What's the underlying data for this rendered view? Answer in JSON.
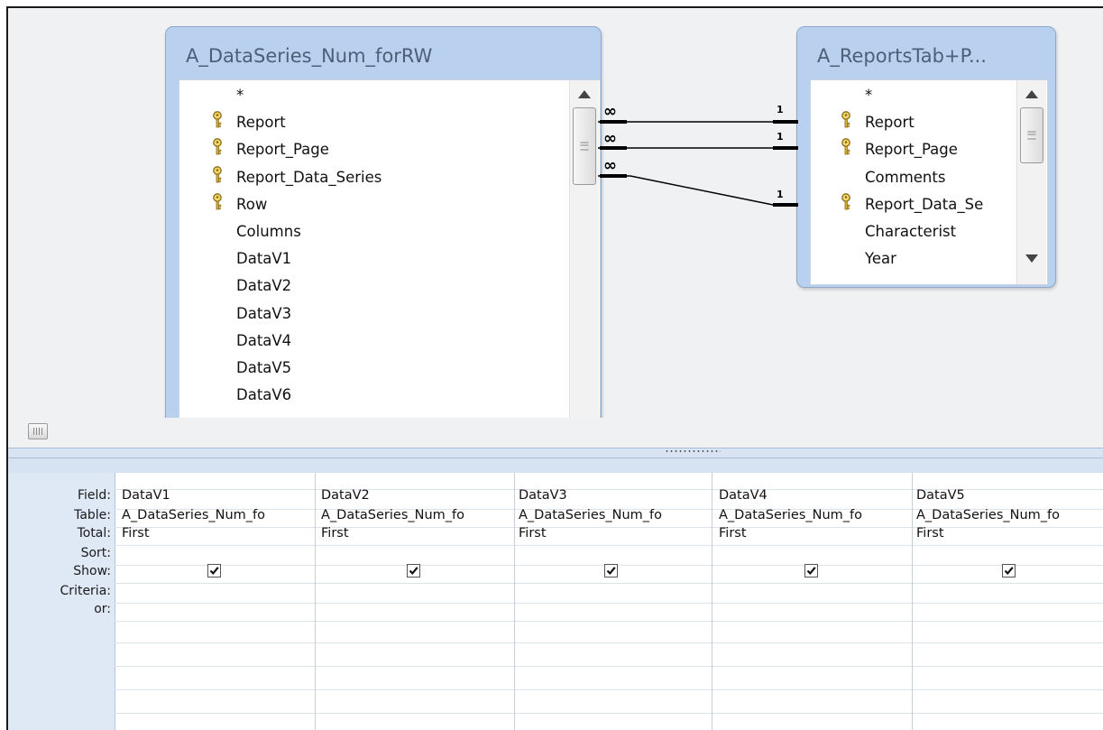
{
  "left_table": {
    "title": "A_DataSeries_Num_forRW",
    "fields": [
      {
        "name": "*",
        "key": false
      },
      {
        "name": "Report",
        "key": true
      },
      {
        "name": "Report_Page",
        "key": true
      },
      {
        "name": "Report_Data_Series",
        "key": true
      },
      {
        "name": "Row",
        "key": true
      },
      {
        "name": "Columns",
        "key": false
      },
      {
        "name": "DataV1",
        "key": false
      },
      {
        "name": "DataV2",
        "key": false
      },
      {
        "name": "DataV3",
        "key": false
      },
      {
        "name": "DataV4",
        "key": false
      },
      {
        "name": "DataV5",
        "key": false
      },
      {
        "name": "DataV6",
        "key": false
      }
    ]
  },
  "right_table": {
    "title": "A_ReportsTab+P...",
    "fields": [
      {
        "name": "*",
        "key": false
      },
      {
        "name": "Report",
        "key": true
      },
      {
        "name": "Report_Page",
        "key": true
      },
      {
        "name": "Comments",
        "key": false
      },
      {
        "name": "Report_Data_Se",
        "key": true
      },
      {
        "name": "Characterist",
        "key": false
      },
      {
        "name": "Year",
        "key": false
      }
    ]
  },
  "relationships": {
    "many_symbol": "∞",
    "one_symbol": "1"
  },
  "grid": {
    "row_labels": [
      "Field:",
      "Table:",
      "Total:",
      "Sort:",
      "Show:",
      "Criteria:",
      "or:"
    ],
    "columns": [
      {
        "field": "DataV1",
        "table": "A_DataSeries_Num_fo",
        "total": "First",
        "sort": "",
        "show": true
      },
      {
        "field": "DataV2",
        "table": "A_DataSeries_Num_fo",
        "total": "First",
        "sort": "",
        "show": true
      },
      {
        "field": "DataV3",
        "table": "A_DataSeries_Num_fo",
        "total": "First",
        "sort": "",
        "show": true
      },
      {
        "field": "DataV4",
        "table": "A_DataSeries_Num_fo",
        "total": "First",
        "sort": "",
        "show": true
      },
      {
        "field": "DataV5",
        "table": "A_DataSeries_Num_fo",
        "total": "First",
        "sort": "",
        "show": true
      }
    ]
  },
  "colors": {
    "table_frame": "#b9d1ee",
    "grid_header": "#dfe8f5",
    "relationship_line": "#000000"
  },
  "icons": {
    "primary_key": "key-icon",
    "scroll_up": "up-arrow-icon",
    "scroll_down": "down-arrow-icon",
    "checkbox": "checkmark-icon"
  }
}
